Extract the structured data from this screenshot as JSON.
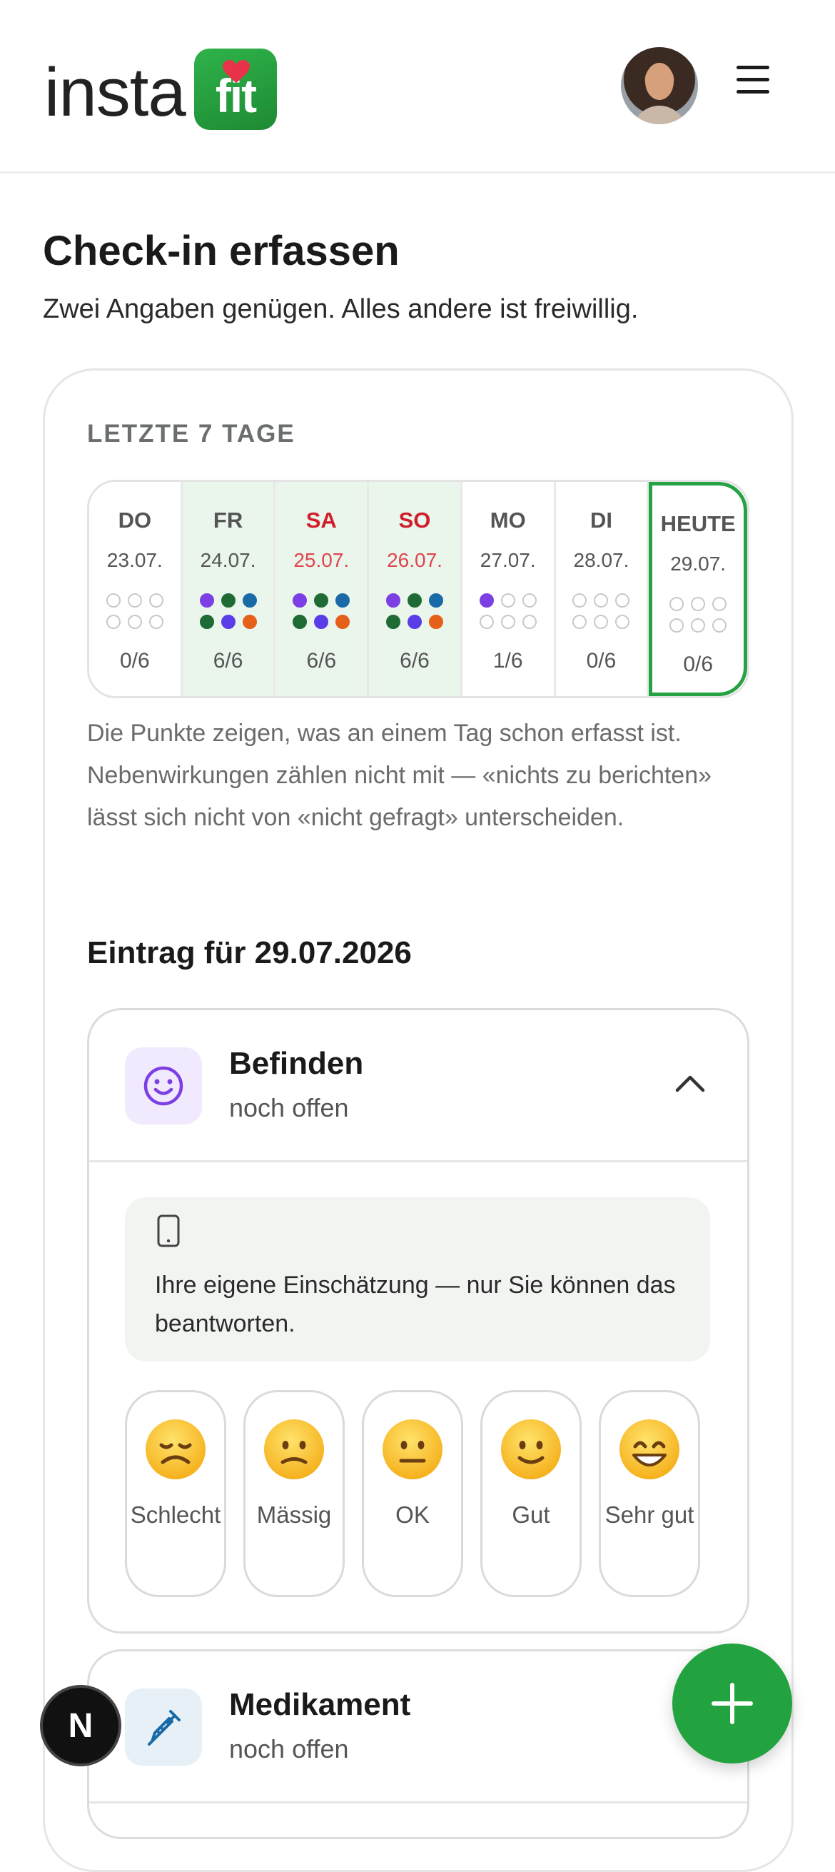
{
  "header": {
    "logo_word": "insta",
    "logo_badge": "fit",
    "avatar_alt": "",
    "menu_icon": "hamburger-menu-icon",
    "brand_color": "#22a33f"
  },
  "page": {
    "title": "Check-in erfassen",
    "subtitle": "Zwei Angaben genügen. Alles andere ist freiwillig."
  },
  "history": {
    "label": "LETZTE 7 TAGE",
    "days": [
      {
        "name": "DO",
        "date": "23.07.",
        "count": "0/6",
        "dots": [
          "",
          "",
          "",
          "",
          "",
          ""
        ],
        "done": false,
        "weekend": false,
        "today": false
      },
      {
        "name": "FR",
        "date": "24.07.",
        "count": "6/6",
        "dots": [
          "#7b3fe4",
          "#1e6b35",
          "#1a6aa8",
          "#1e6b35",
          "#5b3de8",
          "#e5601a"
        ],
        "done": true,
        "weekend": false,
        "today": false
      },
      {
        "name": "SA",
        "date": "25.07.",
        "count": "6/6",
        "dots": [
          "#7b3fe4",
          "#1e6b35",
          "#1a6aa8",
          "#1e6b35",
          "#5b3de8",
          "#e5601a"
        ],
        "done": true,
        "weekend": true,
        "today": false
      },
      {
        "name": "SO",
        "date": "26.07.",
        "count": "6/6",
        "dots": [
          "#7b3fe4",
          "#1e6b35",
          "#1a6aa8",
          "#1e6b35",
          "#5b3de8",
          "#e5601a"
        ],
        "done": true,
        "weekend": true,
        "today": false
      },
      {
        "name": "MO",
        "date": "27.07.",
        "count": "1/6",
        "dots": [
          "#7b3fe4",
          "",
          "",
          "",
          "",
          ""
        ],
        "done": false,
        "weekend": false,
        "today": false
      },
      {
        "name": "DI",
        "date": "28.07.",
        "count": "0/6",
        "dots": [
          "",
          "",
          "",
          "",
          "",
          ""
        ],
        "done": false,
        "weekend": false,
        "today": false
      },
      {
        "name": "HEUTE",
        "date": "29.07.",
        "count": "0/6",
        "dots": [
          "",
          "",
          "",
          "",
          "",
          ""
        ],
        "done": false,
        "weekend": false,
        "today": true
      }
    ],
    "note": "Die Punkte zeigen, was an einem Tag schon erfasst ist. Nebenwirkungen zählen nicht mit — «nichts zu berichten» lässt sich nicht von «nicht gefragt» unterscheiden."
  },
  "entry": {
    "title": "Eintrag für 29.07.2026",
    "wellbeing": {
      "icon": "smiley-icon",
      "title": "Befinden",
      "status": "noch offen",
      "info_icon": "phone-icon",
      "info": "Ihre eigene Einschätzung — nur Sie können das beantworten.",
      "options": [
        {
          "emoji": "😞",
          "label": "Schlecht"
        },
        {
          "emoji": "🙁",
          "label": "Mässig"
        },
        {
          "emoji": "😐",
          "label": "OK"
        },
        {
          "emoji": "🙂",
          "label": "Gut"
        },
        {
          "emoji": "😄",
          "label": "Sehr gut"
        }
      ]
    },
    "medication": {
      "icon": "syringe-icon",
      "title": "Medikament",
      "status": "noch offen"
    }
  },
  "fab_icon": "plus-icon",
  "dev_badge": "N"
}
